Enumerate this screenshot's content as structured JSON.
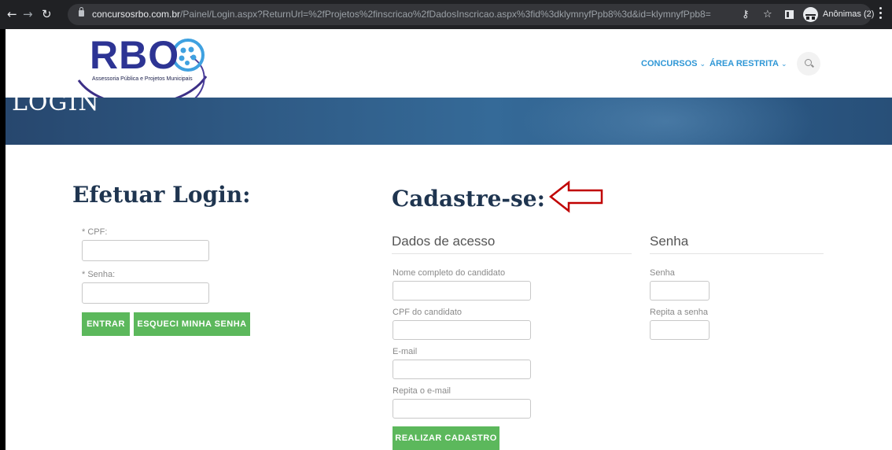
{
  "browser": {
    "url_host": "concursosrbo.com.br",
    "url_path": "/Painel/Login.aspx?ReturnUrl=%2fProjetos%2finscricao%2fDadosInscricao.aspx%3fid%3dklymnyfPpb8%3d&id=klymnyfPpb8=",
    "profile_label": "Anônimas (2)",
    "icons": [
      "back-arrow-icon",
      "forward-arrow-icon",
      "reload-icon",
      "lock-icon",
      "key-icon",
      "star-icon",
      "side-panel-icon",
      "incognito-icon",
      "kebab-menu-icon"
    ]
  },
  "site": {
    "logo_text": "RBO",
    "logo_subtitle": "Assessoria Pública e Projetos Municipais",
    "nav": {
      "concursos": "CONCURSOS",
      "area_restrita": "ÁREA RESTRITA",
      "chevron": "⌄"
    },
    "accent_color": "#2f97d6",
    "button_color": "#5cb85c",
    "heading_color": "#1f3550"
  },
  "banner": {
    "title": "LOGIN"
  },
  "login": {
    "heading": "Efetuar Login:",
    "cpf_label": "* CPF:",
    "cpf_value": "",
    "senha_label": "* Senha:",
    "senha_value": "",
    "enter_button": "ENTRAR",
    "forgot_button": "ESQUECI MINHA SENHA"
  },
  "register": {
    "heading": "Cadastre-se:",
    "access_section": "Dados de acesso",
    "password_section": "Senha",
    "name_label": "Nome completo do candidato",
    "cpf_label": "CPF do candidato",
    "email_label": "E-mail",
    "email_repeat_label": "Repita o e-mail",
    "senha_label": "Senha",
    "senha_repeat_label": "Repita a senha",
    "submit_button": "REALIZAR CADASTRO"
  },
  "annotation": {
    "arrow_color": "#c00000"
  }
}
